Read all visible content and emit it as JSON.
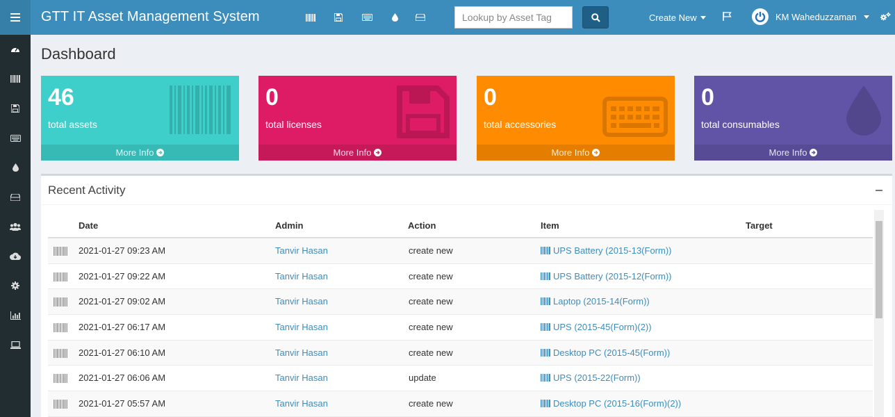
{
  "app": {
    "title": "GTT IT Asset Management System"
  },
  "search": {
    "placeholder": "Lookup by Asset Tag"
  },
  "header": {
    "create_new": "Create New",
    "user_name": "KM Waheduzzaman"
  },
  "page": {
    "title": "Dashboard"
  },
  "stats": [
    {
      "value": "46",
      "label": "total assets",
      "more": "More Info",
      "color": "#3ecfca",
      "icon": "barcode-icon"
    },
    {
      "value": "0",
      "label": "total licenses",
      "more": "More Info",
      "color": "#dd1c65",
      "icon": "floppy-icon"
    },
    {
      "value": "0",
      "label": "total accessories",
      "more": "More Info",
      "color": "#ff8c00",
      "icon": "keyboard-icon"
    },
    {
      "value": "0",
      "label": "total consumables",
      "more": "More Info",
      "color": "#6154a7",
      "icon": "tint-icon"
    }
  ],
  "activity": {
    "title": "Recent Activity",
    "columns": [
      "Date",
      "Admin",
      "Action",
      "Item",
      "Target"
    ],
    "rows": [
      {
        "date": "2021-01-27 09:23 AM",
        "admin": "Tanvir Hasan",
        "action": "create new",
        "item": "UPS Battery (2015-13(Form))",
        "target": ""
      },
      {
        "date": "2021-01-27 09:22 AM",
        "admin": "Tanvir Hasan",
        "action": "create new",
        "item": "UPS Battery (2015-12(Form))",
        "target": ""
      },
      {
        "date": "2021-01-27 09:02 AM",
        "admin": "Tanvir Hasan",
        "action": "create new",
        "item": "Laptop (2015-14(Form))",
        "target": ""
      },
      {
        "date": "2021-01-27 06:17 AM",
        "admin": "Tanvir Hasan",
        "action": "create new",
        "item": "UPS (2015-45(Form)(2))",
        "target": ""
      },
      {
        "date": "2021-01-27 06:10 AM",
        "admin": "Tanvir Hasan",
        "action": "create new",
        "item": "Desktop PC (2015-45(Form))",
        "target": ""
      },
      {
        "date": "2021-01-27 06:06 AM",
        "admin": "Tanvir Hasan",
        "action": "update",
        "item": "UPS (2015-22(Form))",
        "target": ""
      },
      {
        "date": "2021-01-27 05:57 AM",
        "admin": "Tanvir Hasan",
        "action": "create new",
        "item": "Desktop PC (2015-16(Form)(2))",
        "target": ""
      }
    ]
  },
  "colors": {
    "sidebar": "#222d32",
    "header": "#3c8dbc",
    "link": "#3c8dbc"
  }
}
